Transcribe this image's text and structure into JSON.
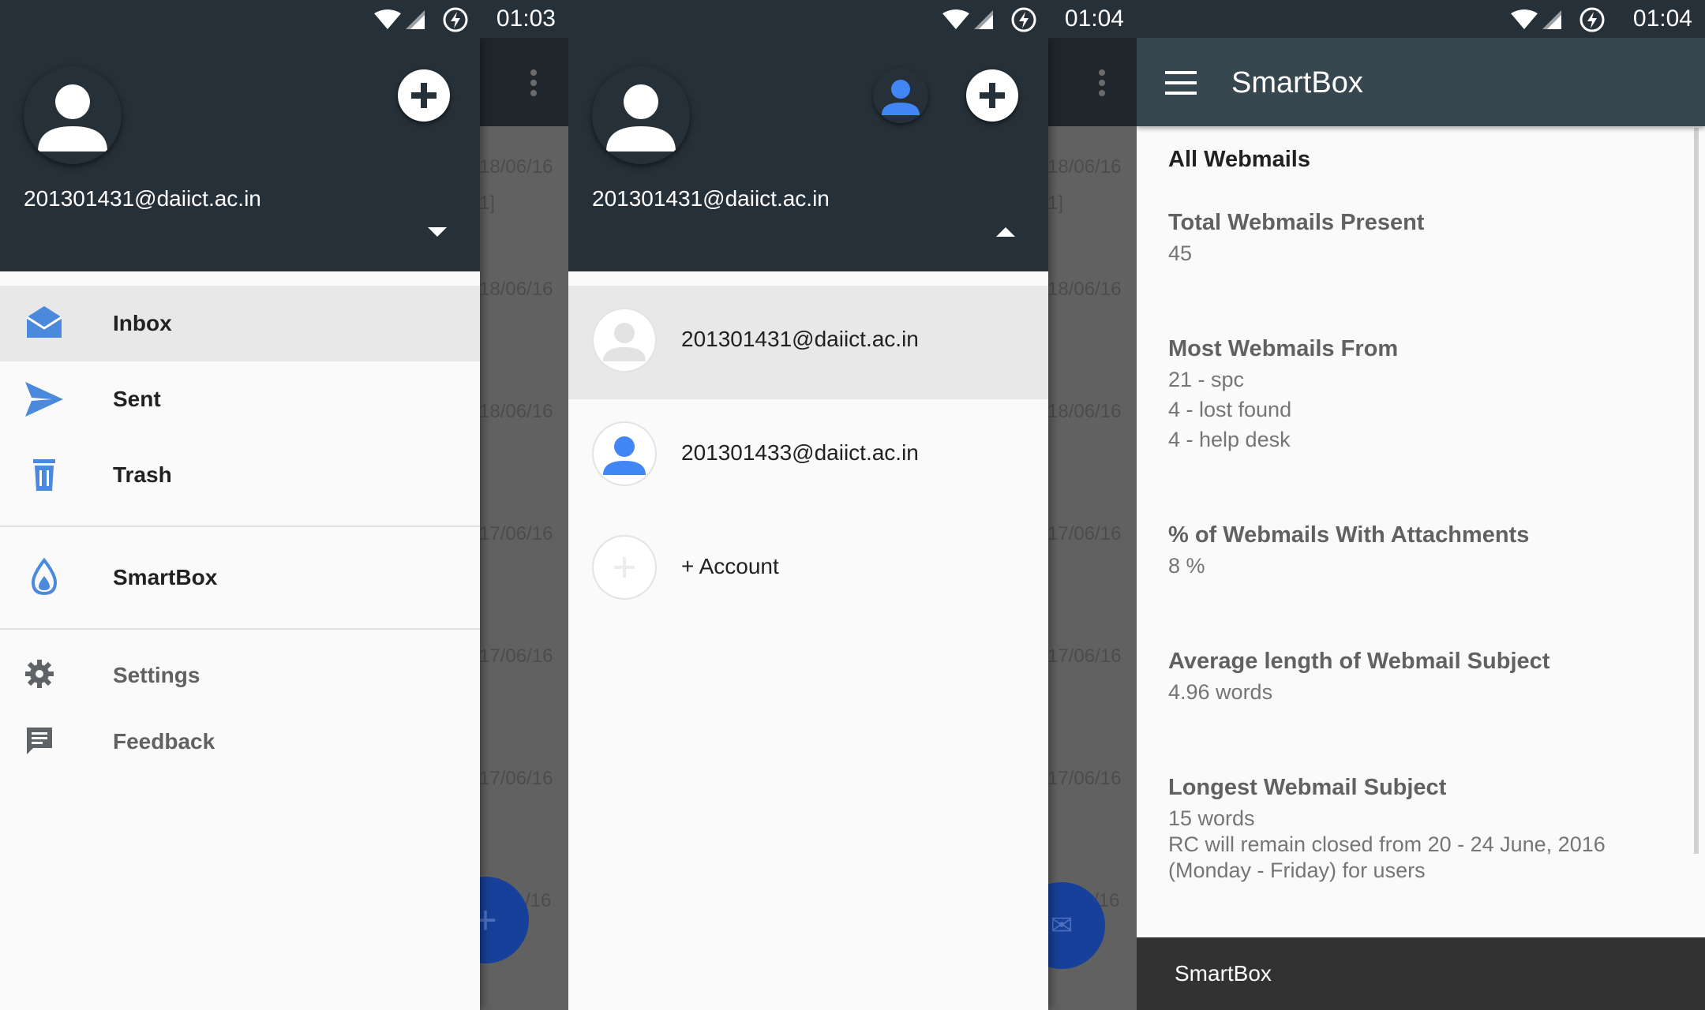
{
  "screen1": {
    "time": "01:03",
    "account_email": "201301431@daiict.ac.in",
    "nav": [
      {
        "label": "Inbox",
        "icon": "inbox-icon"
      },
      {
        "label": "Sent",
        "icon": "send-icon"
      },
      {
        "label": "Trash",
        "icon": "trash-icon"
      },
      {
        "label": "SmartBox",
        "icon": "flame-icon"
      },
      {
        "label": "Settings",
        "icon": "gear-icon"
      },
      {
        "label": "Feedback",
        "icon": "feedback-icon"
      }
    ],
    "behind_dates": [
      "18/06/16",
      "18/06/16",
      "18/06/16",
      "17/06/16",
      "17/06/16",
      "17/06/16",
      "/16"
    ],
    "behind_bracket": "1]"
  },
  "screen2": {
    "time": "01:04",
    "account_email": "201301431@daiict.ac.in",
    "accounts": [
      {
        "label": "201301431@daiict.ac.in"
      },
      {
        "label": "201301433@daiict.ac.in"
      },
      {
        "label": "+ Account"
      }
    ],
    "behind_dates": [
      "18/06/16",
      "18/06/16",
      "18/06/16",
      "17/06/16",
      "17/06/16",
      "17/06/16",
      "/16"
    ],
    "behind_bracket": "1]"
  },
  "screen3": {
    "time": "01:04",
    "title": "SmartBox",
    "section_title": "All Webmails",
    "stats": [
      {
        "heading": "Total Webmails Present",
        "lines": [
          "45"
        ]
      },
      {
        "heading": "Most Webmails From",
        "lines": [
          "21 - spc",
          "4 - lost found",
          "4 - help desk"
        ]
      },
      {
        "heading": "% of Webmails With Attachments",
        "lines": [
          "8 %"
        ]
      },
      {
        "heading": "Average length of Webmail Subject",
        "lines": [
          "4.96 words"
        ]
      },
      {
        "heading": "Longest Webmail Subject",
        "lines": [
          "15 words",
          "RC will remain closed from 20 - 24 June, 2016",
          "(Monday - Friday) for users"
        ]
      }
    ],
    "bottom_bar": "SmartBox"
  },
  "colors": {
    "header": "#263038",
    "accent_blue": "#4285f4",
    "appbar": "#37474f"
  }
}
